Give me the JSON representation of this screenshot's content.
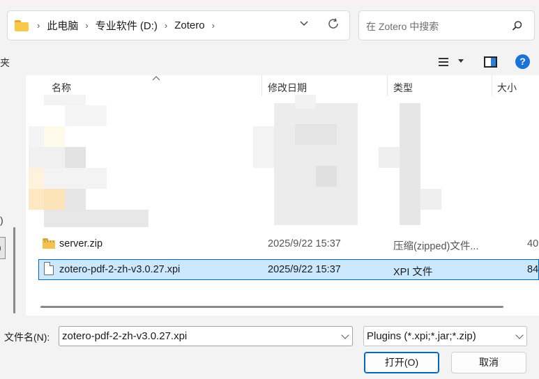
{
  "address": {
    "breadcrumb": [
      "此电脑",
      "专业软件 (D:)",
      "Zotero"
    ]
  },
  "search": {
    "placeholder": "在 Zotero 中搜索"
  },
  "left_label": "夹",
  "nav_glyphs": [
    ")",
    ")"
  ],
  "columns": {
    "name": "名称",
    "modified": "修改日期",
    "type": "类型",
    "size": "大小"
  },
  "files": [
    {
      "name": "server.zip",
      "modified": "2025/9/22 15:37",
      "type": "压缩(zipped)文件...",
      "size": "40",
      "icon": "zip-folder-icon",
      "selected": false
    },
    {
      "name": "zotero-pdf-2-zh-v3.0.27.xpi",
      "modified": "2025/9/22 15:37",
      "type": "XPI 文件",
      "size": "84",
      "icon": "document-icon",
      "selected": true
    }
  ],
  "bottom": {
    "filename_label": "文件名(N):",
    "filename_value": "zotero-pdf-2-zh-v3.0.27.xpi",
    "filter_value": "Plugins (*.xpi;*.jar;*.zip)",
    "open_label": "打开(O)",
    "cancel_label": "取消"
  },
  "toolbar": {
    "help_glyph": "?"
  },
  "colors": {
    "selection": "#cce8ff",
    "selection_border": "#0067c0",
    "accent": "#1a73d9"
  }
}
